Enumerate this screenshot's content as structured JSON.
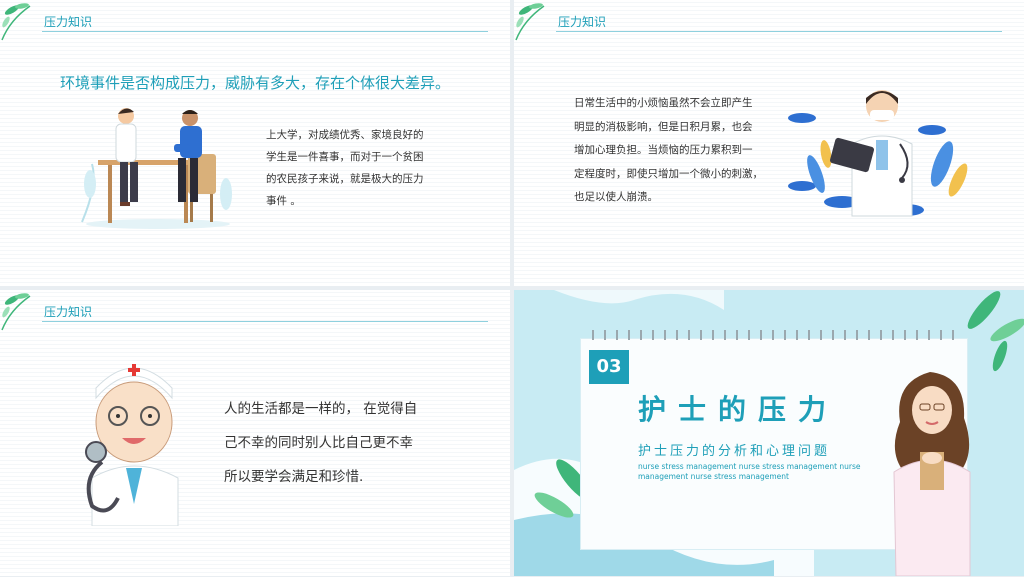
{
  "slides": [
    {
      "header": "压力知识",
      "heading": "环境事件是否构成压力，威胁有多大，存在个体很大差异。",
      "paragraph": [
        "上大学，对成绩优秀、家境良好的",
        "学生是一件喜事，而对于一个贫困",
        "的农民孩子来说，就是极大的压力",
        "事件 。"
      ]
    },
    {
      "header": "压力知识",
      "paragraph": [
        "日常生活中的小烦恼虽然不会立即产生",
        "明显的消极影响，但是日积月累，也会",
        "增加心理负担。当烦恼的压力累积到一",
        "定程度时，即使只增加一个微小的刺激，",
        "也足以使人崩溃。"
      ]
    },
    {
      "header": "压力知识",
      "paragraph": [
        "人的生活都是一样的， 在觉得自",
        "己不幸的同时别人比自己更不幸",
        "所以要学会满足和珍惜."
      ]
    },
    {
      "badge": "03",
      "title": "护士的压力",
      "subtitle": "护士压力的分析和心理问题",
      "english": "nurse stress management nurse stress management nurse management nurse stress management"
    }
  ],
  "colors": {
    "accent": "#1e9fb8",
    "leaf": "#3fb67a",
    "cloud": "#2e6fd1"
  }
}
